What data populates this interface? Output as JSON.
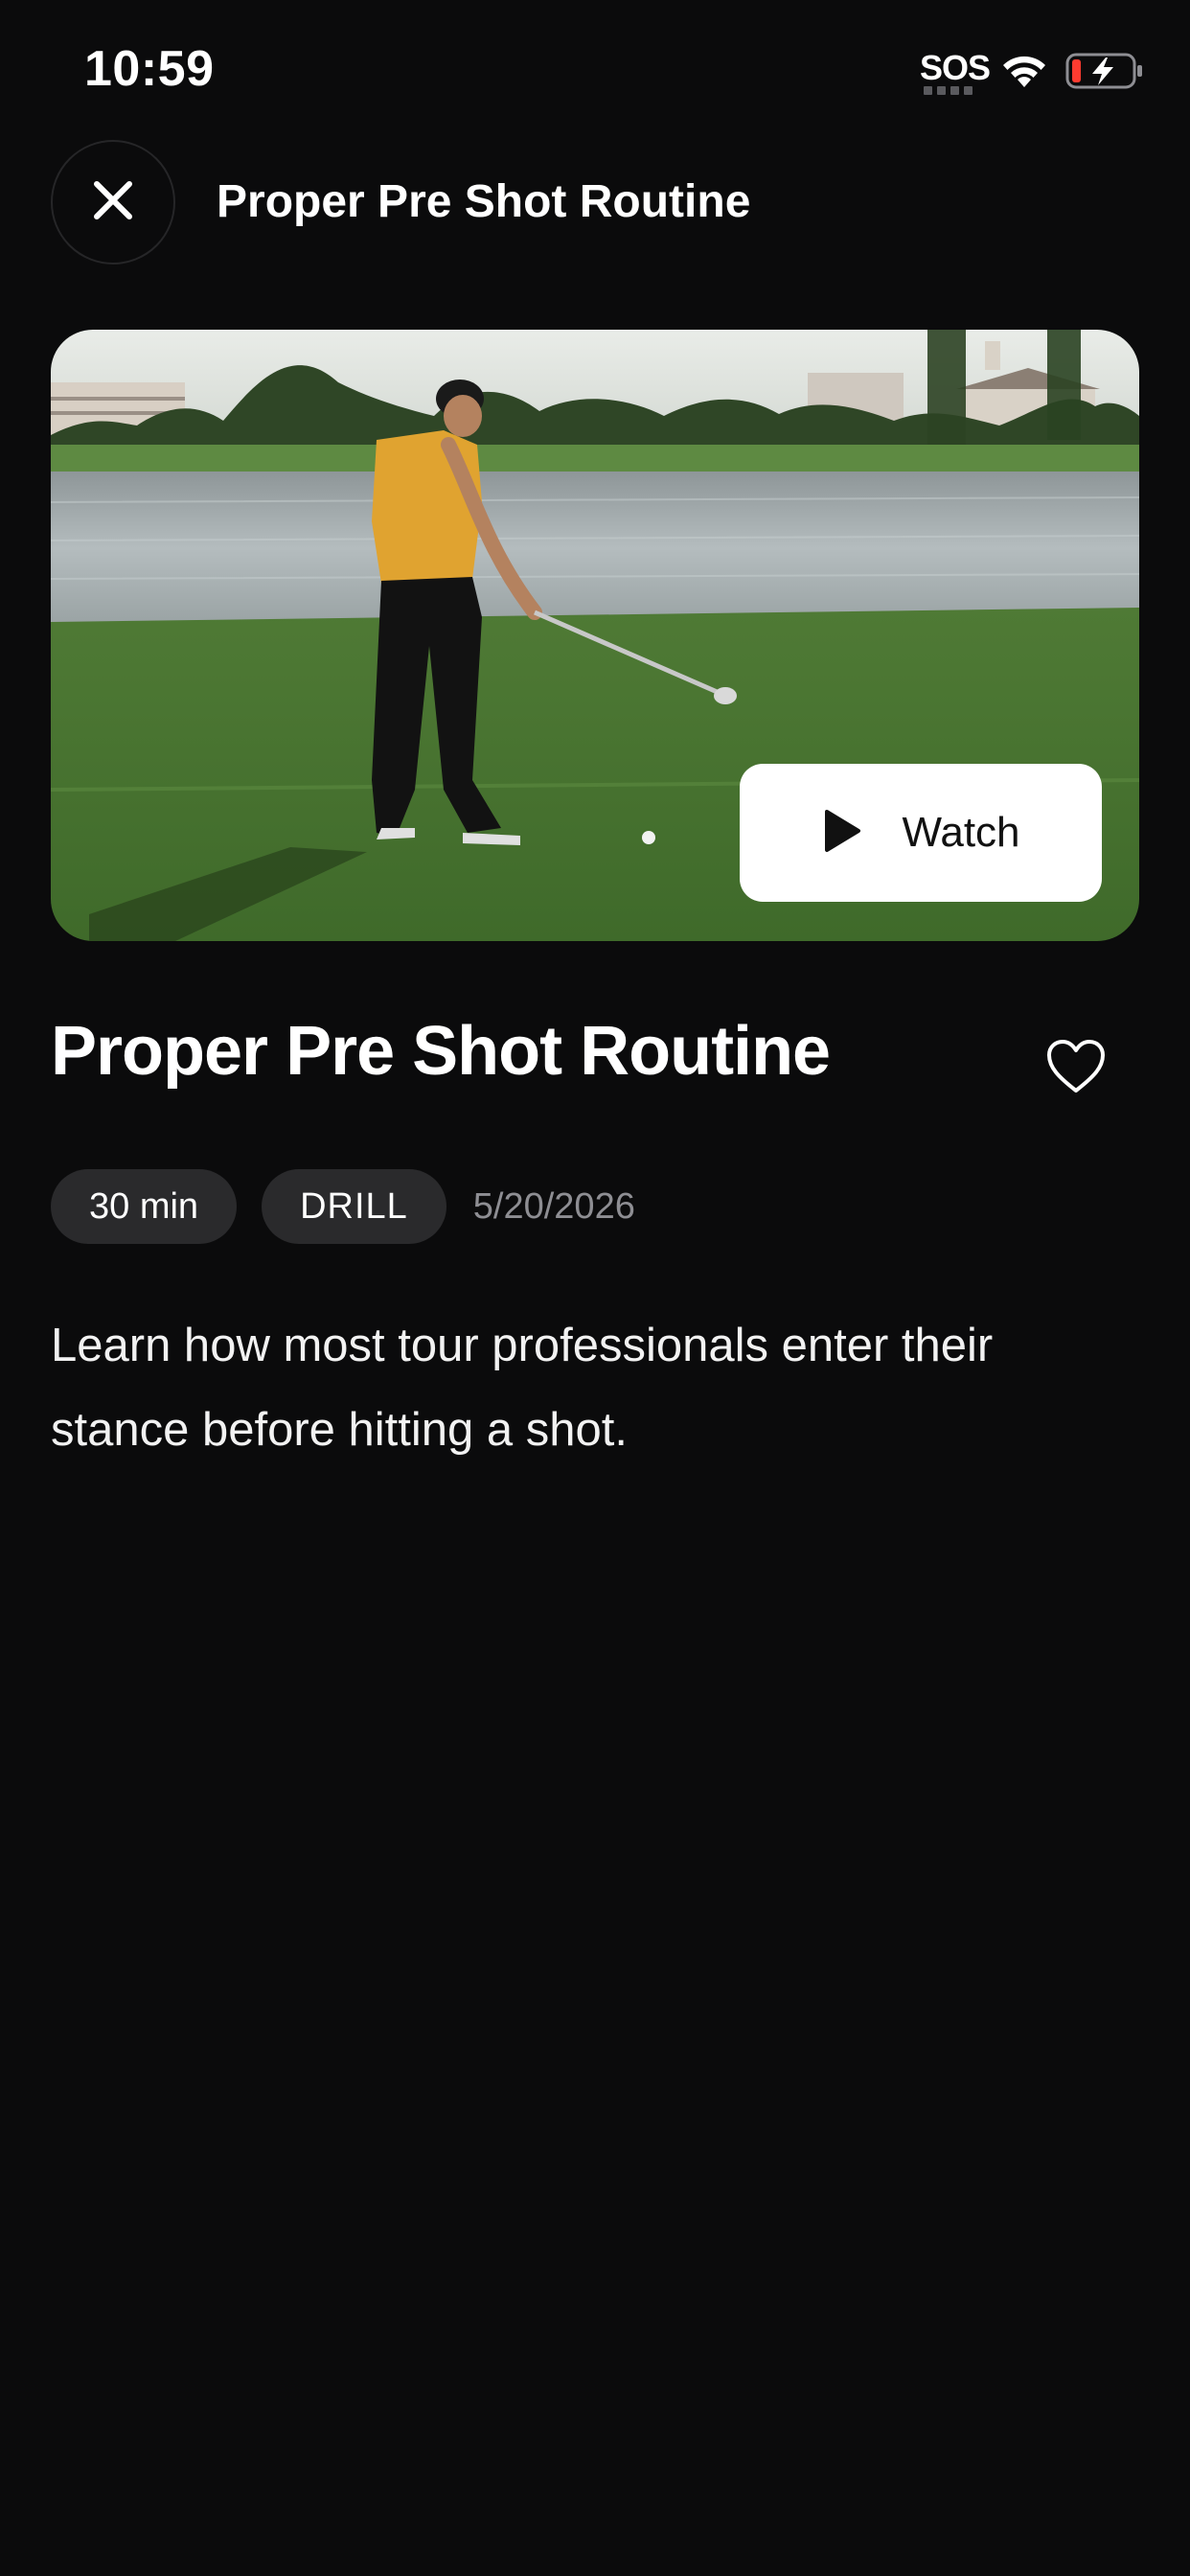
{
  "status_bar": {
    "time": "10:59",
    "sos_label": "SOS",
    "wifi_icon": "wifi-icon",
    "battery_icon": "battery-charging-icon",
    "battery_color": "#ff3b30"
  },
  "header": {
    "close_icon": "close-icon",
    "title": "Proper Pre Shot Routine"
  },
  "video": {
    "thumbnail": "golfer-on-course-thumbnail",
    "watch_label": "Watch",
    "play_icon": "play-icon"
  },
  "lesson": {
    "title": "Proper Pre Shot Routine",
    "favorite_icon": "heart-icon",
    "duration": "30 min",
    "type": "DRILL",
    "date": "5/20/2026",
    "description": "Learn how most tour professionals enter their stance before hitting a shot."
  },
  "colors": {
    "background": "#0b0b0c",
    "pill_background": "#2a2a2c",
    "button_background": "#ffffff",
    "muted_text": "#8e8e93"
  }
}
